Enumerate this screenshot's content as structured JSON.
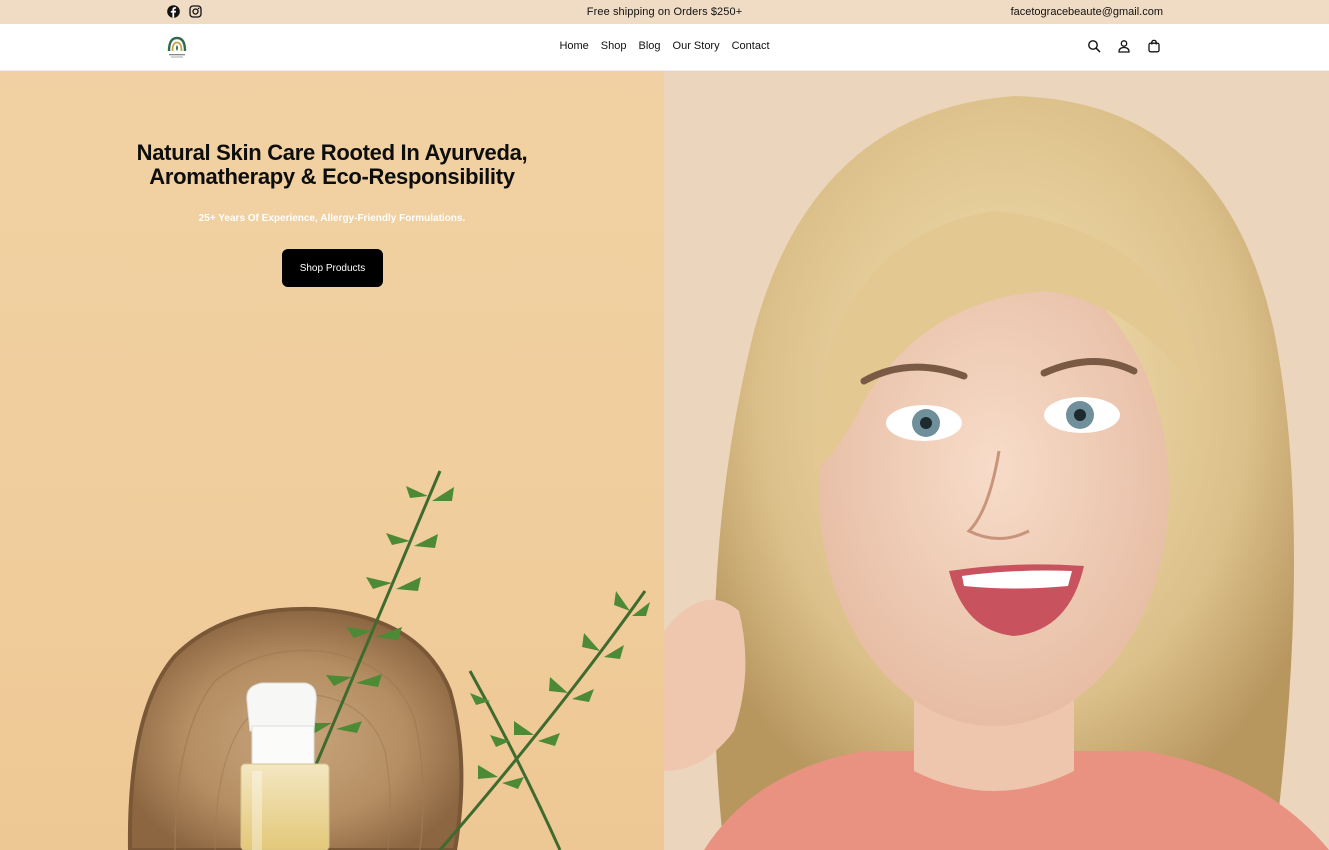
{
  "announcement": {
    "text": "Free shipping on Orders $250+",
    "email": "facetogracebeaute@gmail.com",
    "social": [
      "facebook-icon",
      "instagram-icon"
    ]
  },
  "header": {
    "nav": [
      "Home",
      "Shop",
      "Blog",
      "Our Story",
      "Contact"
    ],
    "icons": [
      "search-icon",
      "account-icon",
      "cart-icon"
    ]
  },
  "hero": {
    "title_line1": "Natural Skin Care Rooted In Ayurveda,",
    "title_line2": "Aromatherapy & Eco-Responsibility",
    "subtitle": "25+ Years Of Experience, Allergy-Friendly Formulations.",
    "cta": "Shop Products"
  },
  "colors": {
    "announcement_bg": "#f0dcc4",
    "hero_left_bg": "#f1d1a3",
    "hero_right_bg": "#ebd5bc",
    "button_bg": "#000000",
    "logo_green": "#2e6b4f"
  }
}
